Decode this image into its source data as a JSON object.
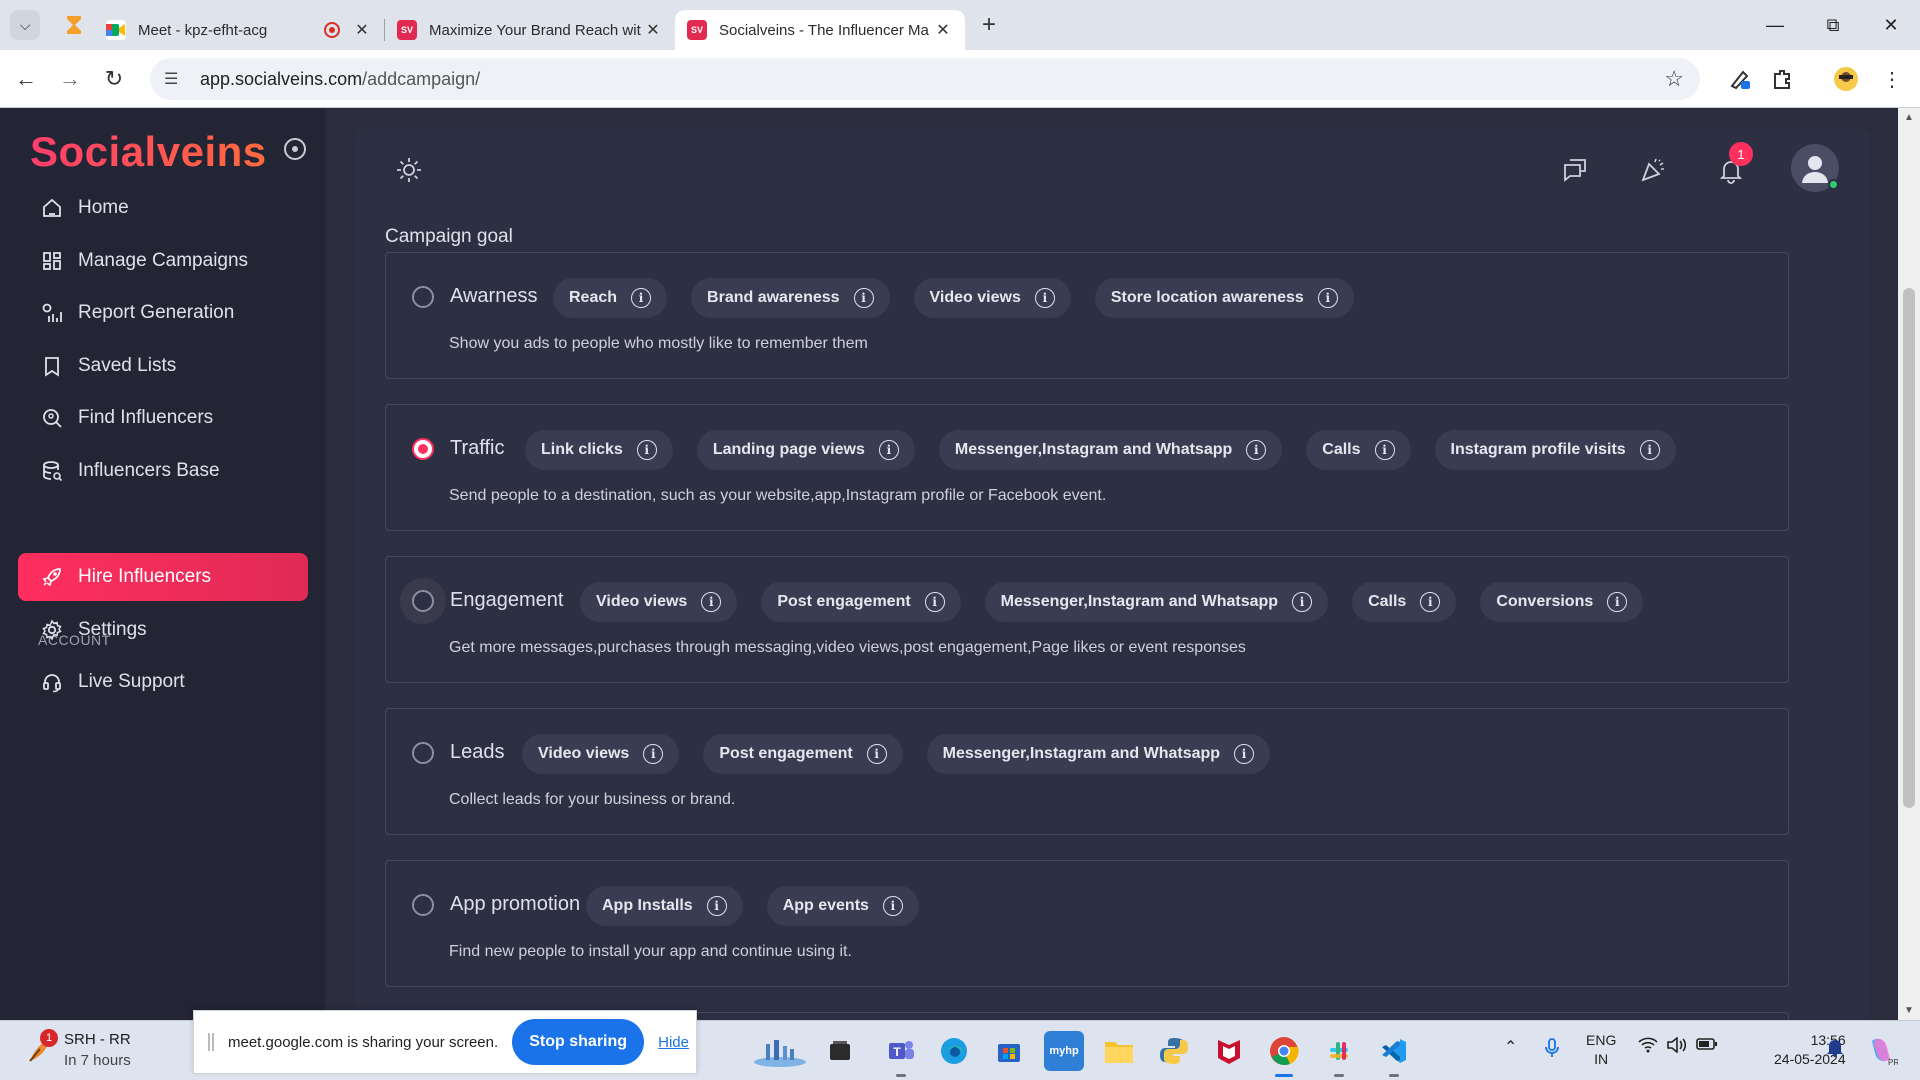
{
  "browser": {
    "tabs": [
      {
        "title": "Meet - kpz-efht-acg",
        "favicon": "google-meet-icon",
        "recording": true
      },
      {
        "title": "Maximize Your Brand Reach wit",
        "favicon": "SV"
      },
      {
        "title": "Socialveins - The Influencer Ma",
        "favicon": "SV",
        "active": true
      }
    ],
    "url_host": "app.socialveins.com",
    "url_path": "/addcampaign/"
  },
  "app": {
    "logo": "Socialveins",
    "nav": [
      {
        "label": "Home",
        "icon": "home-icon"
      },
      {
        "label": "Manage Campaigns",
        "icon": "grid-icon"
      },
      {
        "label": "Report Generation",
        "icon": "report-icon"
      },
      {
        "label": "Saved Lists",
        "icon": "bookmark-icon"
      },
      {
        "label": "Find Influencers",
        "icon": "search-user-icon"
      },
      {
        "label": "Influencers Base",
        "icon": "database-search-icon"
      }
    ],
    "account_section": "ACCOUNT",
    "account_nav": [
      {
        "label": "Hire Influencers",
        "icon": "rocket-icon",
        "active": true
      },
      {
        "label": "Settings",
        "icon": "gear-icon"
      },
      {
        "label": "Live Support",
        "icon": "headset-icon"
      }
    ],
    "notification_count": "1",
    "accent_color": "#ff2f5e"
  },
  "campaign": {
    "section_label": "Campaign goal",
    "goals": [
      {
        "name": "Awarness",
        "checked": false,
        "chips": [
          "Reach",
          "Brand awareness",
          "Video views",
          "Store location awareness"
        ],
        "description": "Show you ads to people who mostly like to remember them"
      },
      {
        "name": "Traffic",
        "checked": true,
        "chips": [
          "Link clicks",
          "Landing page views",
          "Messenger,Instagram and Whatsapp",
          "Calls",
          "Instagram profile visits"
        ],
        "description": "Send people to a destination, such as your website,app,Instagram profile or Facebook event."
      },
      {
        "name": "Engagement",
        "checked": false,
        "chips": [
          "Video views",
          "Post engagement",
          "Messenger,Instagram and Whatsapp",
          "Calls",
          "Conversions"
        ],
        "description": "Get more messages,purchases through messaging,video views,post engagement,Page likes or event responses"
      },
      {
        "name": "Leads",
        "checked": false,
        "chips": [
          "Video views",
          "Post engagement",
          "Messenger,Instagram and Whatsapp"
        ],
        "description": "Collect leads for your business or brand."
      },
      {
        "name": "App promotion",
        "checked": false,
        "chips": [
          "App Installs",
          "App events"
        ],
        "description": "Find new people to install your app and continue using it."
      }
    ]
  },
  "taskbar": {
    "weather_badge": "1",
    "weather_title": "SRH - RR",
    "weather_sub": "In 7 hours",
    "share_message": "meet.google.com is sharing your screen.",
    "stop_sharing": "Stop sharing",
    "hide": "Hide",
    "lang_1": "ENG",
    "lang_2": "IN",
    "time": "13:56",
    "date": "24-05-2024"
  }
}
